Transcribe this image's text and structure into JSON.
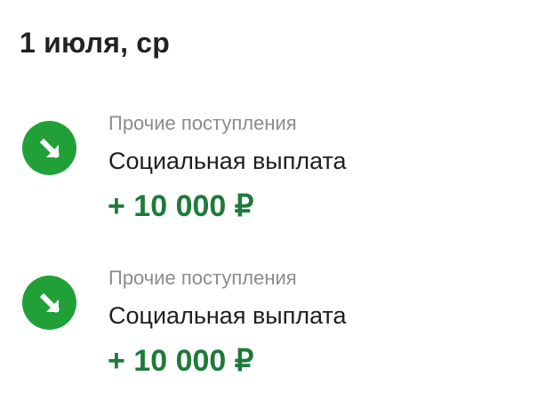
{
  "day_group": {
    "date_label": "1 июля, ср",
    "transactions": [
      {
        "icon": "arrow-down-right-icon",
        "category": "Прочие поступления",
        "title": "Социальная выплата",
        "amount": "+ 10 000 ₽"
      },
      {
        "icon": "arrow-down-right-icon",
        "category": "Прочие поступления",
        "title": "Социальная выплата",
        "amount": "+ 10 000 ₽"
      }
    ]
  },
  "colors": {
    "icon_bg": "#21a038",
    "amount": "#1e7a39",
    "category": "#8c8c8c",
    "title": "#1f1f1f",
    "header": "#222222"
  }
}
